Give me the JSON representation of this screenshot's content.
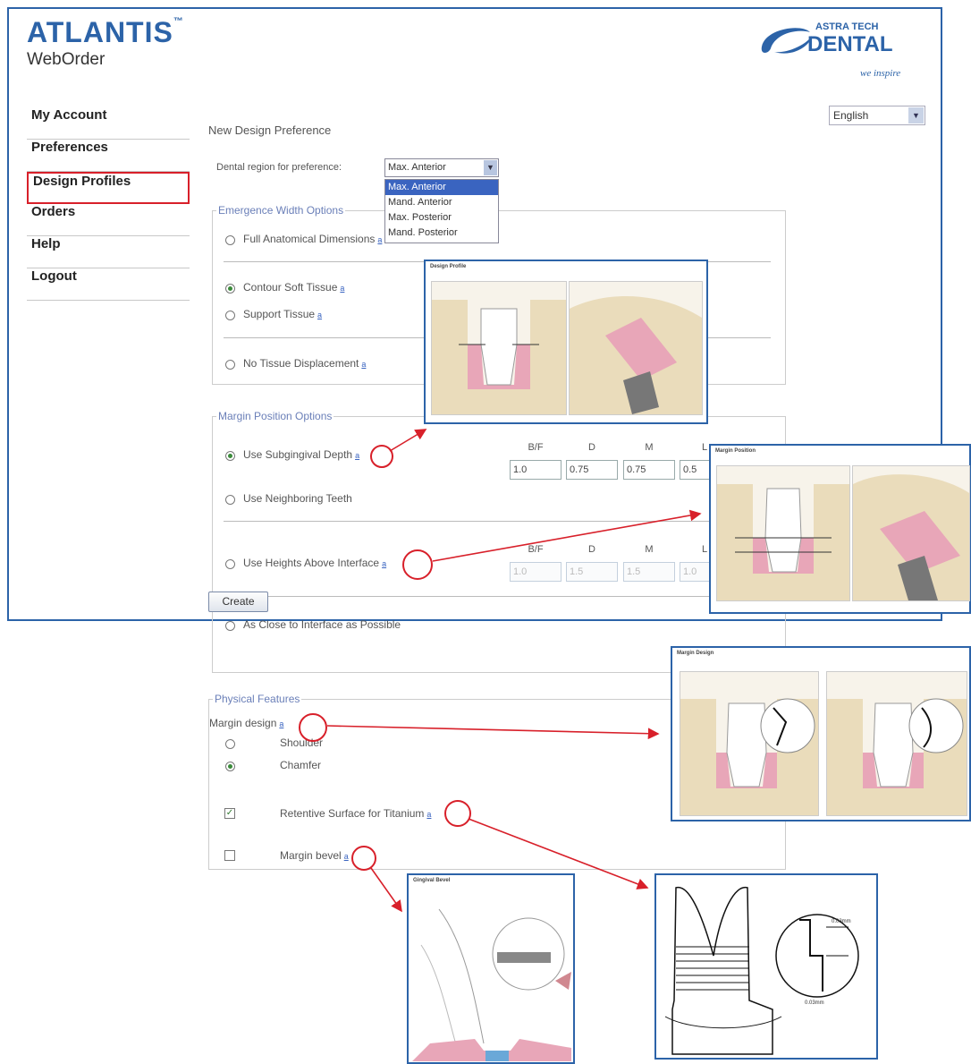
{
  "brand": {
    "logo_title": "ATLANTIS",
    "logo_tm": "™",
    "logo_subtitle": "WebOrder",
    "partner_line1": "ASTRA TECH",
    "partner_line2": "DENTAL",
    "partner_tagline": "we inspire"
  },
  "nav": {
    "items": [
      {
        "label": "My Account"
      },
      {
        "label": "Preferences"
      },
      {
        "label": "Design Profiles",
        "highlighted": true
      },
      {
        "label": "Orders"
      },
      {
        "label": "Help"
      },
      {
        "label": "Logout"
      }
    ]
  },
  "language": {
    "selected": "English"
  },
  "page_title": "New Design Preference",
  "region": {
    "label": "Dental region for preference:",
    "selected": "Max. Anterior",
    "options": [
      "Max. Anterior",
      "Mand. Anterior",
      "Max. Posterior",
      "Mand. Posterior"
    ]
  },
  "emergence": {
    "legend": "Emergence Width Options",
    "full_anatomical": "Full Anatomical Dimensions",
    "contour_soft": "Contour Soft Tissue",
    "support_tissue": "Support Tissue",
    "no_displacement": "No Tissue Displacement",
    "selected": "contour_soft"
  },
  "margin": {
    "legend": "Margin Position Options",
    "subgingival": "Use Subgingival Depth",
    "neighboring": "Use Neighboring Teeth",
    "heights": "Use Heights Above Interface",
    "close": "As Close to Interface as Possible",
    "selected": "subgingival",
    "col_bf": "B/F",
    "col_d": "D",
    "col_m": "M",
    "col_l": "L",
    "depth_values": [
      "1.0",
      "0.75",
      "0.75",
      "0.5"
    ],
    "height_values": [
      "1.0",
      "1.5",
      "1.5",
      "1.0"
    ]
  },
  "physical": {
    "legend": "Physical Features",
    "margin_design_label": "Margin design",
    "shoulder": "Shoulder",
    "chamfer": "Chamfer",
    "margin_selected": "chamfer",
    "retentive": "Retentive Surface for Titanium",
    "retentive_checked": true,
    "bevel": "Margin bevel",
    "bevel_checked": false
  },
  "info_link": "a",
  "create_button": "Create",
  "popups": {
    "emergence_title": "Design Profile",
    "margin_position_title": "Margin Position",
    "margin_design_title": "Margin Design",
    "bevel_title": "Gingival Bevel",
    "retentive_dim1": "0.03mm",
    "retentive_dim2": "0.03mm"
  },
  "colors": {
    "brand_blue": "#2c63a8",
    "callout_red": "#d8202a",
    "tissue_pink": "#e8a6b8",
    "bone_tan": "#eadcbb"
  }
}
